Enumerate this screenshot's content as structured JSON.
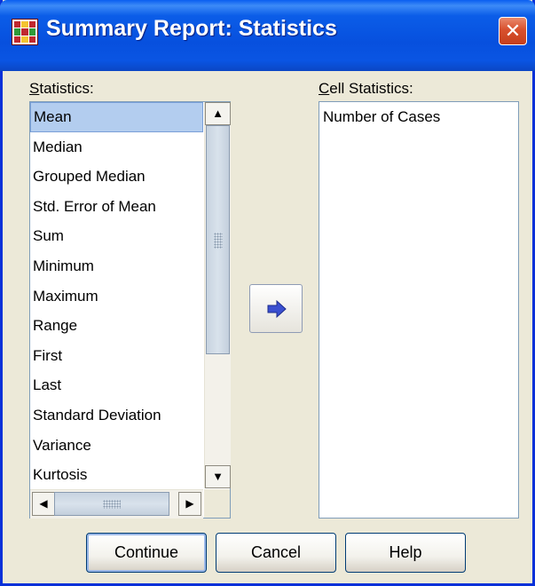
{
  "window": {
    "title": "Summary Report: Statistics",
    "close_glyph": "✕"
  },
  "statistics": {
    "label_mnemonic": "S",
    "label_rest": "tatistics:",
    "items": [
      "Mean",
      "Median",
      "Grouped Median",
      "Std. Error of Mean",
      "Sum",
      "Minimum",
      "Maximum",
      "Range",
      "First",
      "Last",
      "Standard Deviation",
      "Variance",
      "Kurtosis"
    ],
    "selected": "Mean"
  },
  "cell_statistics": {
    "label_mnemonic": "C",
    "label_rest": "ell Statistics:",
    "items": [
      "Number of Cases"
    ]
  },
  "buttons": {
    "continue": "Continue",
    "cancel": "Cancel",
    "help": "Help"
  },
  "icons": {
    "move": "right-arrow-icon",
    "app": "summary-report-icon"
  },
  "colors": {
    "titlebar": "#0750de",
    "selection": "#b3cdef",
    "arrow": "#3a4fd0"
  }
}
